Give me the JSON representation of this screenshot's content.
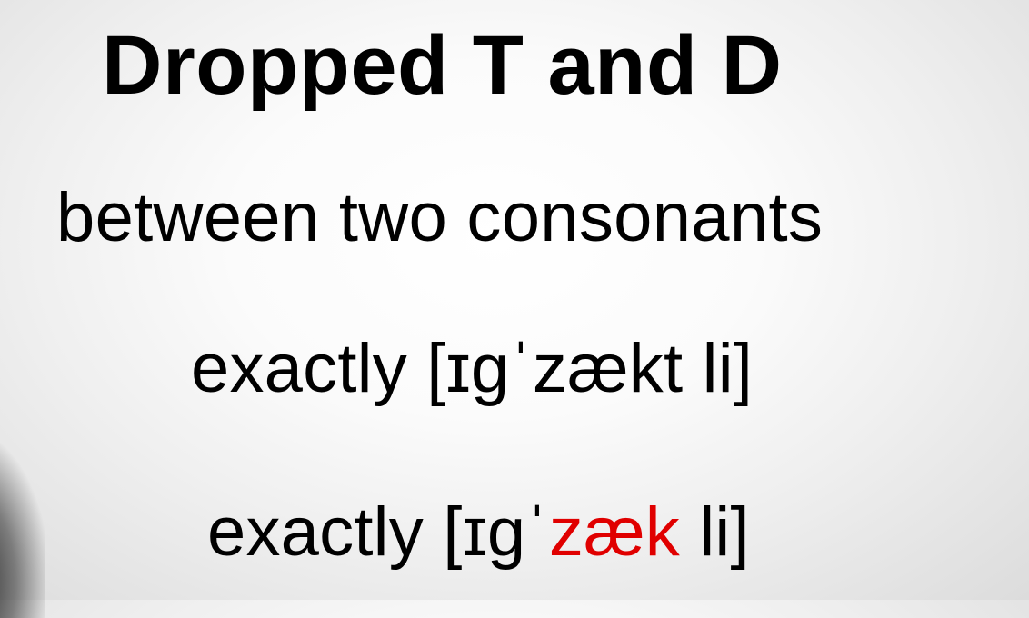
{
  "slide": {
    "title": "Dropped T and D",
    "subtitle": "between two consonants",
    "example_full": {
      "word": "exactly",
      "pron_open": "[ɪɡˈ",
      "pron_main": "zækt",
      "pron_close": " li]"
    },
    "example_dropped": {
      "word": "exactly",
      "pron_open": "[ɪɡˈ",
      "pron_main": "zæk",
      "pron_close": " li]",
      "highlight_color": "#e00000"
    }
  }
}
